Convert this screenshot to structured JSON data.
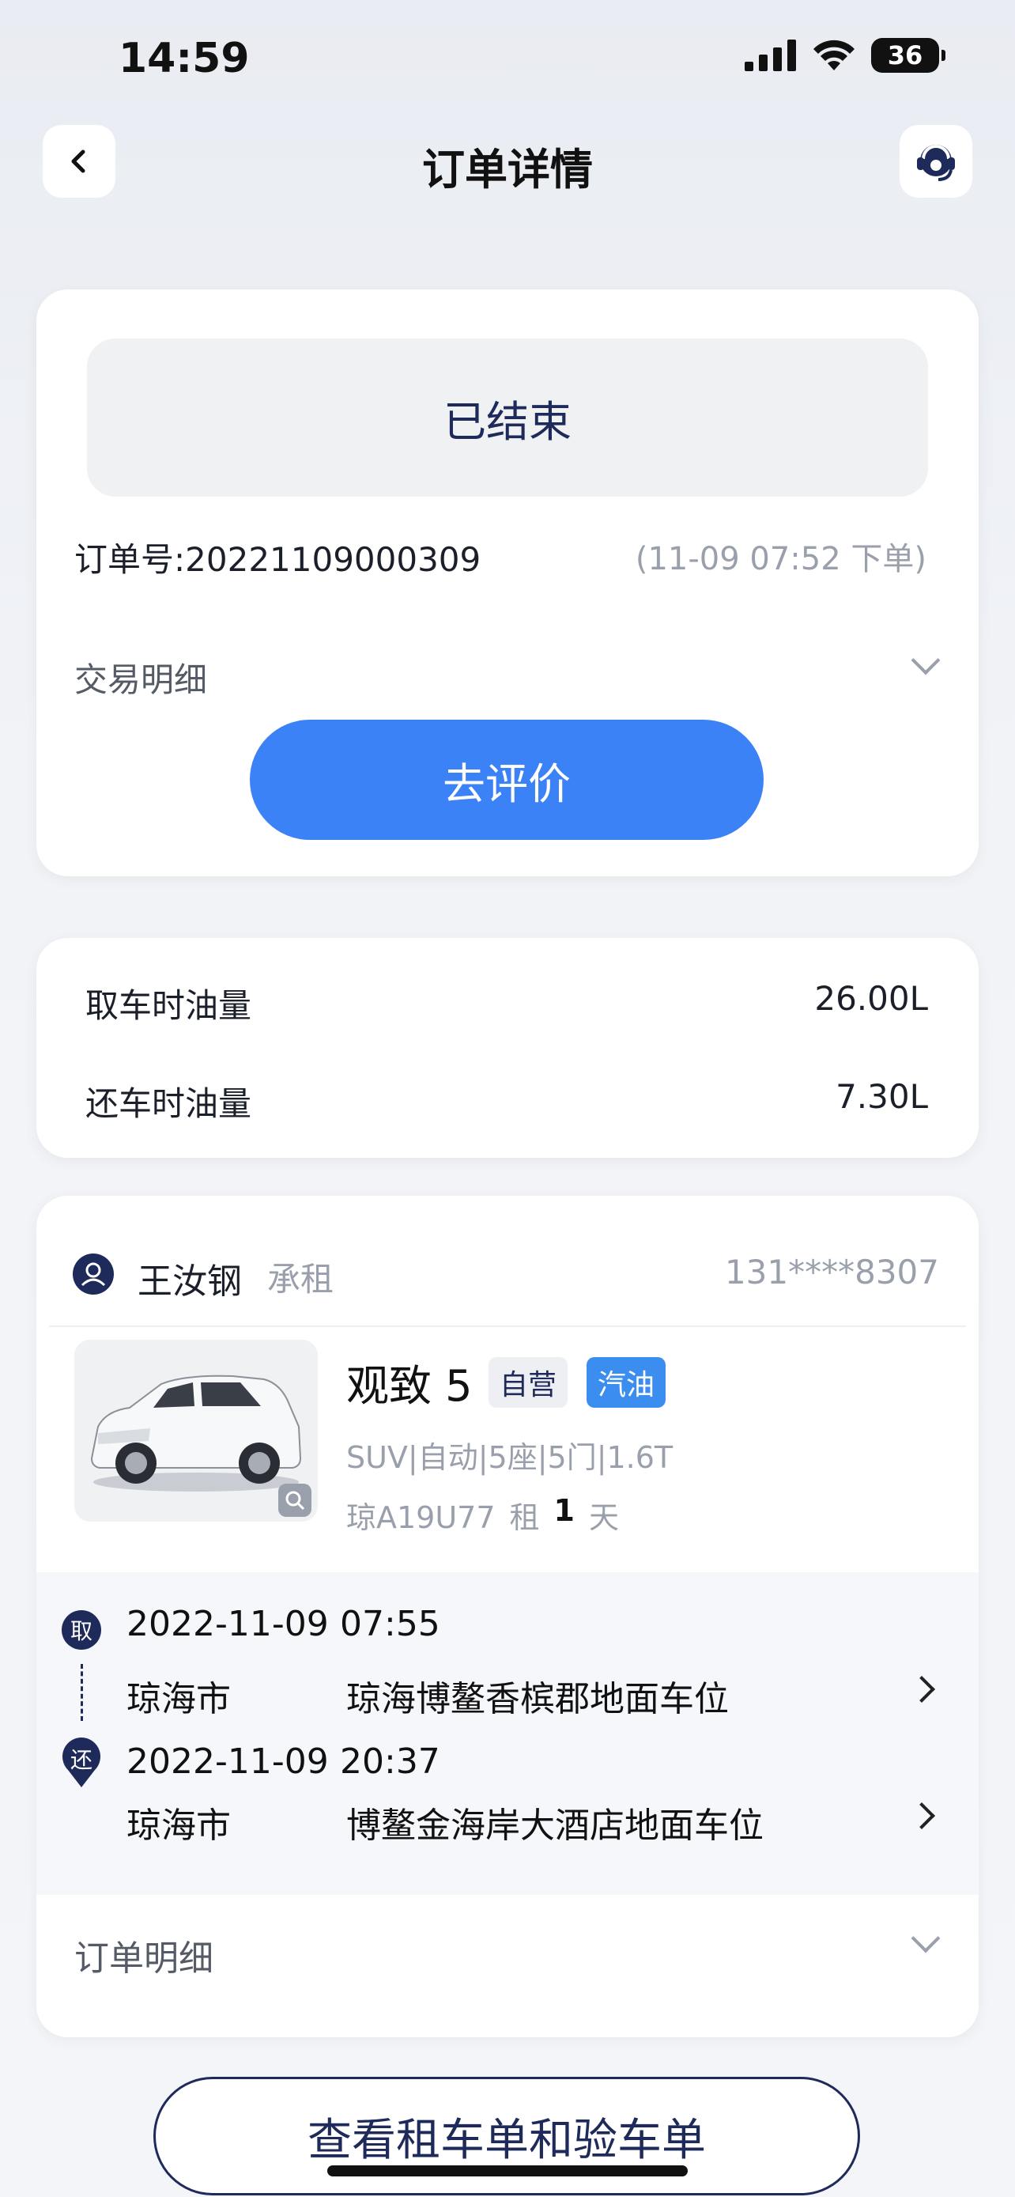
{
  "status_bar": {
    "time": "14:59",
    "battery": "36"
  },
  "header": {
    "title": "订单详情"
  },
  "order": {
    "status": "已结束",
    "number_label": "订单号:20221109000309",
    "time_label": "(11-09 07:52 下单)",
    "transaction_detail": "交易明细",
    "review_button": "去评价"
  },
  "fuel": {
    "pickup_label": "取车时油量",
    "pickup_value": "26.00L",
    "return_label": "还车时油量",
    "return_value": "7.30L"
  },
  "renter": {
    "name": "王汝钢",
    "role": "承租",
    "phone": "131****8307"
  },
  "car": {
    "model": "观致 5",
    "tag_owner": "自营",
    "tag_fuel": "汽油",
    "specs": "SUV|自动|5座|5门|1.6T",
    "plate": "琼A19U77",
    "rent_prefix": "租",
    "rent_days": "1",
    "rent_unit": "天"
  },
  "route": {
    "pickup_badge": "取",
    "pickup_date": "2022-11-09",
    "pickup_time": "07:55",
    "pickup_city": "琼海市",
    "pickup_place": "琼海博鳌香槟郡地面车位",
    "return_badge": "还",
    "return_date": "2022-11-09",
    "return_time": "20:37",
    "return_city": "琼海市",
    "return_place": "博鳌金海岸大酒店地面车位"
  },
  "order_detail": "订单明细",
  "bottom_button": "查看租车单和验车单",
  "colors": {
    "primary": "#3b82f6",
    "navy": "#1e2a5a",
    "fuel_tag": "#3b8ef0"
  }
}
